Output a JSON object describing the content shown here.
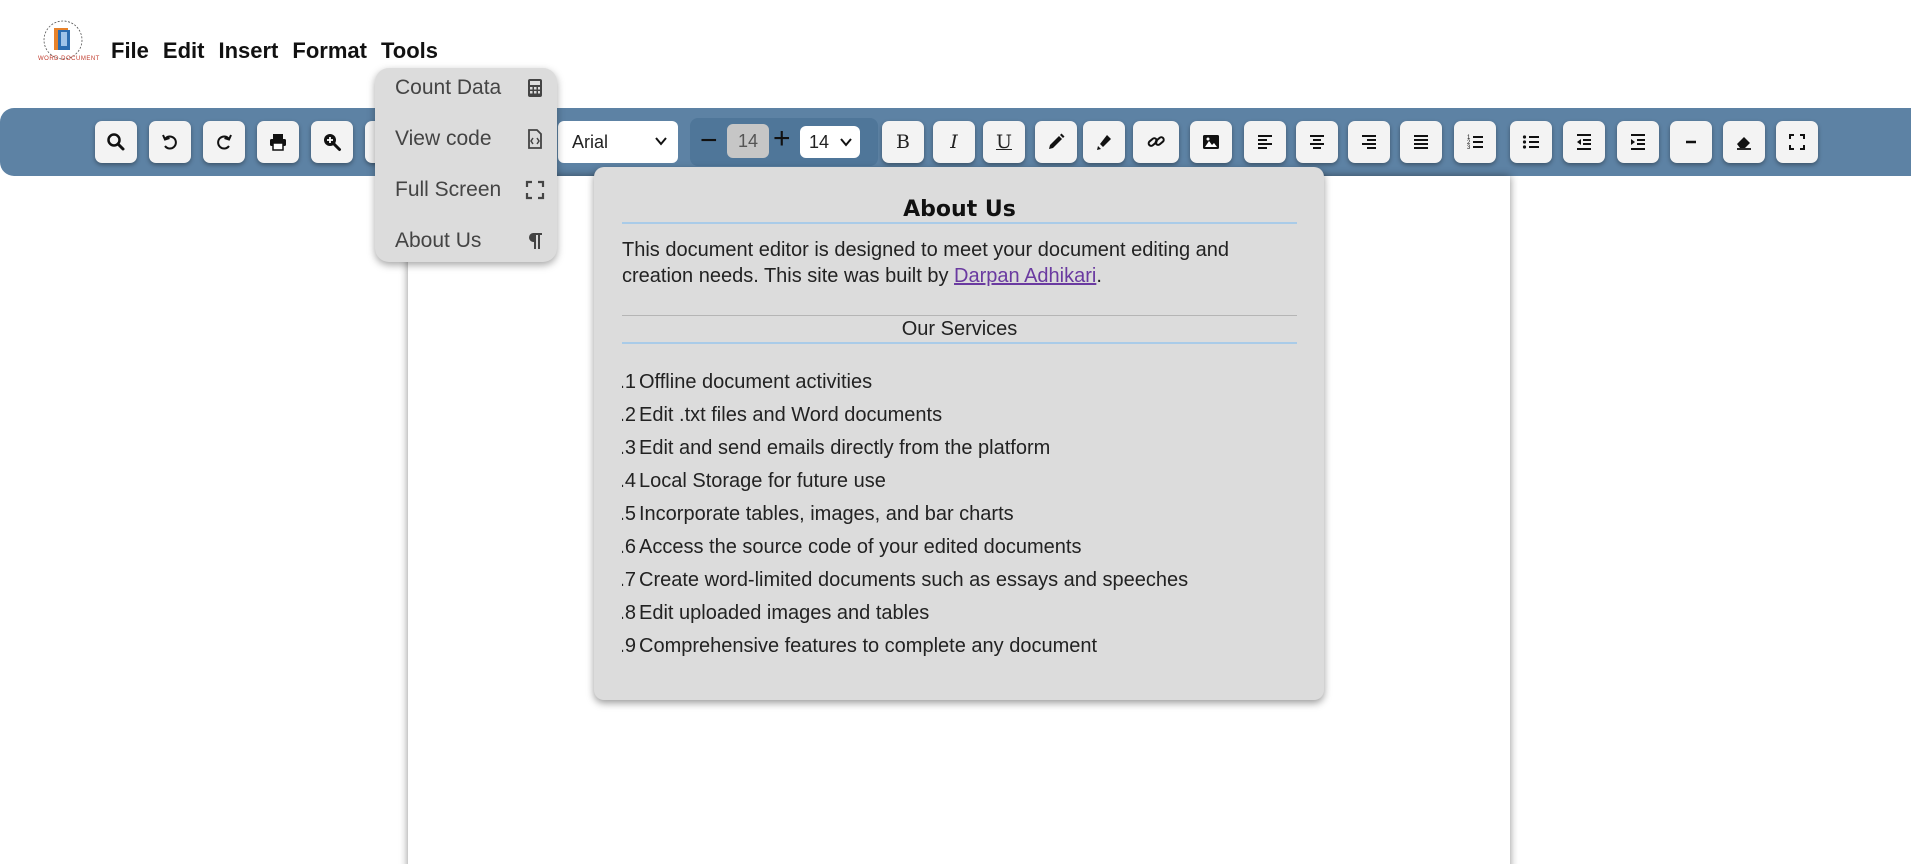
{
  "logo": {
    "text": "WORD DOCUMENT"
  },
  "menu": [
    "File",
    "Edit",
    "Insert",
    "Format",
    "Tools"
  ],
  "toolbar": {
    "font_family": "Arial",
    "font_size_value": "14",
    "font_size_select": "14",
    "bold_label": "B",
    "italic_label": "I",
    "underline_label": "U",
    "minus_symbol": "−",
    "plus_symbol": "+"
  },
  "tools_menu": {
    "items": [
      {
        "label": "Count Data",
        "icon": "calculator-icon"
      },
      {
        "label": "View code",
        "icon": "code-file-icon"
      },
      {
        "label": "Full Screen",
        "icon": "fullscreen-icon"
      },
      {
        "label": "About Us",
        "icon": "paragraph-icon"
      }
    ]
  },
  "about": {
    "title": "About Us",
    "intro_before": "This document editor is designed to meet your document editing and creation needs. This site was built by ",
    "author_link": "Darpan Adhikari",
    "intro_after": ".",
    "services_heading": "Our Services",
    "services": [
      {
        "num": "1.",
        "text": "Offline document activities"
      },
      {
        "num": "2.",
        "text": "Edit .txt files and Word documents"
      },
      {
        "num": "3.",
        "text": "Edit and send emails directly from the platform"
      },
      {
        "num": "4.",
        "text": "Local Storage for future use"
      },
      {
        "num": "5.",
        "text": "Incorporate tables, images, and bar charts"
      },
      {
        "num": "6.",
        "text": "Access the source code of your edited documents"
      },
      {
        "num": "7.",
        "text": "Create word-limited documents such as essays and speeches"
      },
      {
        "num": "8.",
        "text": "Edit uploaded images and tables"
      },
      {
        "num": "9.",
        "text": "Comprehensive features to complete any document"
      }
    ]
  },
  "colors": {
    "toolbar_bg": "#5d82a4",
    "modal_bg": "#dcdcdc",
    "link": "#6a3aa0"
  }
}
